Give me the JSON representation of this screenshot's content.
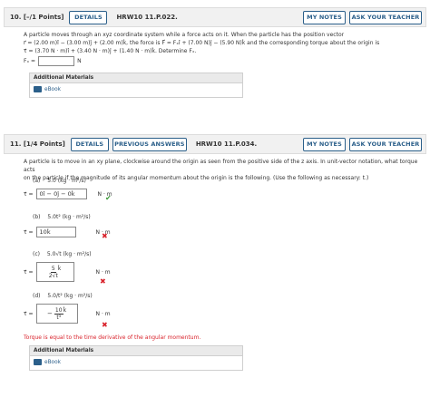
{
  "q10": {
    "number": "10.",
    "points": "[–/1 Points]",
    "details_label": "DETAILS",
    "code": "HRW10 11.P.022.",
    "my_notes_label": "MY NOTES",
    "ask_label": "ASK YOUR TEACHER",
    "line1": "A particle moves through an xyz coordinate system while a force acts on it. When the particle has the position vector",
    "line2": "r⃗ = (2.00 m)î − (3.00 m)ĵ + (2.00 m)k̂, the force is F⃗ = Fₓî + (7.00 N)ĵ − (5.90 N)k̂ and the corresponding torque about the origin is",
    "line3": "τ⃗ = (3.70 N · m)î + (3.40 N · m)ĵ + (1.40 N · m)k̂. Determine Fₓ.",
    "answer_prefix": "Fₓ =",
    "answer_value": "",
    "unit": "N",
    "additional_materials": "Additional Materials",
    "ebook": "eBook"
  },
  "q11": {
    "number": "11.",
    "points": "[1/4 Points]",
    "details_label": "DETAILS",
    "prev_label": "PREVIOUS ANSWERS",
    "code": "HRW10 11.P.034.",
    "my_notes_label": "MY NOTES",
    "ask_label": "ASK YOUR TEACHER",
    "line1": "A particle is to move in an xy plane, clockwise around the origin as seen from the positive side of the z axis. In unit-vector notation, what torque acts",
    "line2": "on the particle if the magnitude of its angular momentum about the origin is the following. (Use the following as necessary: t.)",
    "parts": [
      {
        "label": "(a)",
        "given": "5.0 (kg · m²/s)",
        "prefix": "τ⃗ =",
        "answer": "0î − 0ĵ − 0k̂",
        "unit": "N · m",
        "status": "correct"
      },
      {
        "label": "(b)",
        "given": "5.0t² (kg · m²/s)",
        "prefix": "τ⃗ =",
        "answer": "10k̂",
        "unit": "N · m",
        "status": "wrong"
      },
      {
        "label": "(c)",
        "given": "5.0√t (kg · m²/s)",
        "prefix": "τ⃗ =",
        "answer_num": "5",
        "answer_den": "2√t",
        "answer_vec": "k̂",
        "unit": "N · m",
        "status": "wrong"
      },
      {
        "label": "(d)",
        "given": "5.0/t² (kg · m²/s)",
        "prefix": "τ⃗ =",
        "answer_sign": "−",
        "answer_num": "10",
        "answer_den": "t³",
        "answer_vec": "k̂",
        "unit": "N · m",
        "status": "wrong"
      }
    ],
    "feedback": "Torque is equal to the time derivative of the angular momentum.",
    "additional_materials": "Additional Materials",
    "ebook": "eBook"
  },
  "colors": {
    "accent": "#2b5f8a",
    "error": "#d9232c",
    "success": "#3a9a36"
  },
  "icons": {
    "correct": "check-icon",
    "wrong": "x-icon",
    "ebook": "book-icon"
  }
}
